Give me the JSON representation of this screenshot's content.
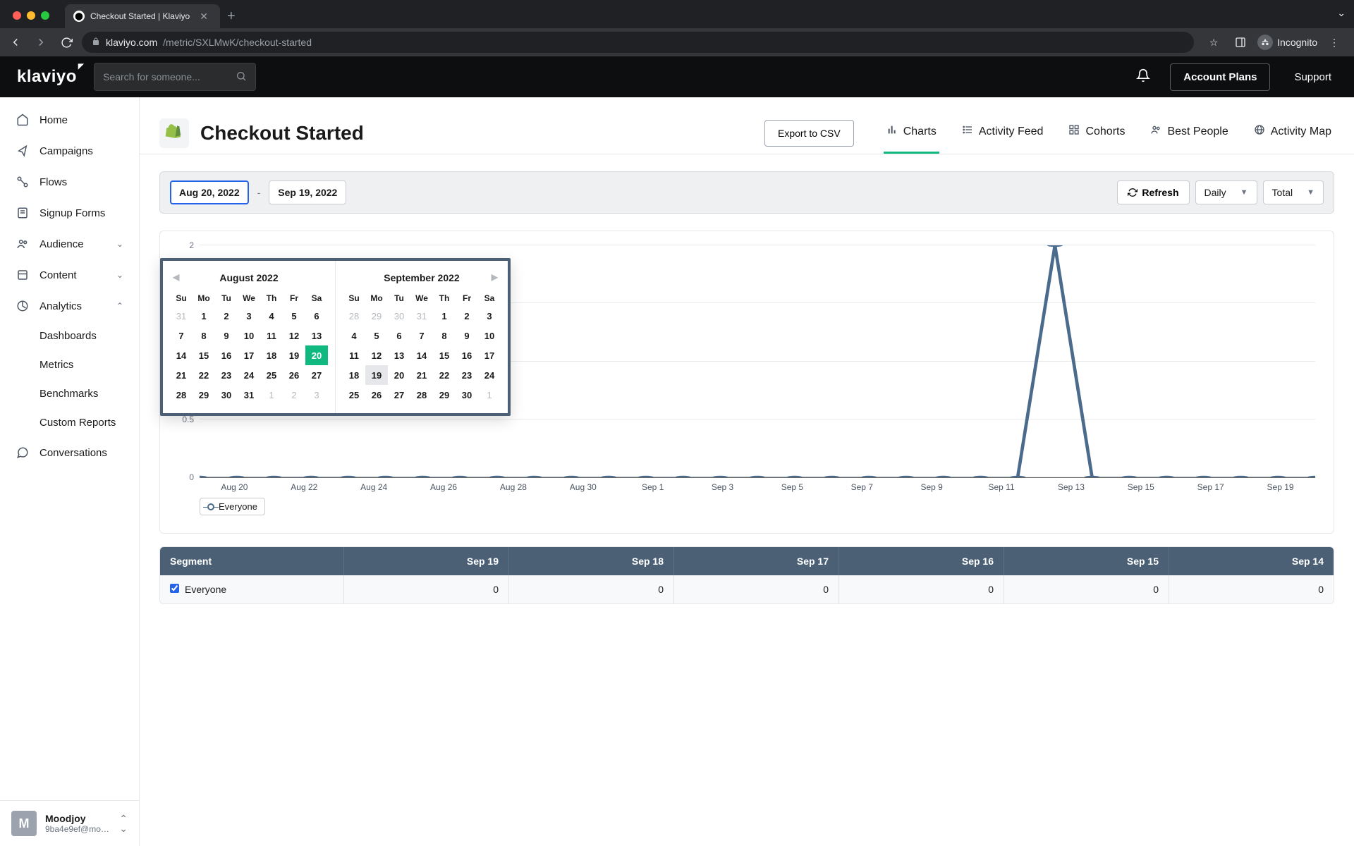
{
  "browser": {
    "tab_title": "Checkout Started | Klaviyo",
    "url_host": "klaviyo.com",
    "url_path": "/metric/SXLMwK/checkout-started",
    "incognito_label": "Incognito"
  },
  "header": {
    "logo_text": "klaviyo",
    "search_placeholder": "Search for someone...",
    "account_plans": "Account Plans",
    "support": "Support"
  },
  "sidebar": {
    "items": [
      {
        "icon": "home",
        "label": "Home"
      },
      {
        "icon": "send",
        "label": "Campaigns"
      },
      {
        "icon": "flow",
        "label": "Flows"
      },
      {
        "icon": "form",
        "label": "Signup Forms"
      },
      {
        "icon": "audience",
        "label": "Audience",
        "expandable": true
      },
      {
        "icon": "content",
        "label": "Content",
        "expandable": true
      },
      {
        "icon": "analytics",
        "label": "Analytics",
        "expandable": true,
        "expanded": true,
        "children": [
          "Dashboards",
          "Metrics",
          "Benchmarks",
          "Custom Reports"
        ]
      },
      {
        "icon": "chat",
        "label": "Conversations"
      }
    ],
    "account": {
      "avatar": "M",
      "name": "Moodjoy",
      "email": "9ba4e9ef@moo..."
    }
  },
  "page": {
    "title": "Checkout Started",
    "export_label": "Export to CSV",
    "tabs": [
      {
        "icon": "chart",
        "label": "Charts",
        "active": true
      },
      {
        "icon": "list",
        "label": "Activity Feed"
      },
      {
        "icon": "grid",
        "label": "Cohorts"
      },
      {
        "icon": "people",
        "label": "Best People"
      },
      {
        "icon": "map",
        "label": "Activity Map"
      }
    ]
  },
  "toolbar": {
    "date_from": "Aug 20, 2022",
    "date_to": "Sep 19, 2022",
    "refresh": "Refresh",
    "granularity": "Daily",
    "aggregation": "Total"
  },
  "calendar": {
    "left": {
      "title": "August 2022",
      "dow": [
        "Su",
        "Mo",
        "Tu",
        "We",
        "Th",
        "Fr",
        "Sa"
      ],
      "weeks": [
        [
          {
            "d": "31",
            "muted": true
          },
          {
            "d": "1"
          },
          {
            "d": "2"
          },
          {
            "d": "3"
          },
          {
            "d": "4"
          },
          {
            "d": "5"
          },
          {
            "d": "6"
          }
        ],
        [
          {
            "d": "7"
          },
          {
            "d": "8"
          },
          {
            "d": "9"
          },
          {
            "d": "10"
          },
          {
            "d": "11"
          },
          {
            "d": "12"
          },
          {
            "d": "13"
          }
        ],
        [
          {
            "d": "14"
          },
          {
            "d": "15"
          },
          {
            "d": "16"
          },
          {
            "d": "17"
          },
          {
            "d": "18"
          },
          {
            "d": "19"
          },
          {
            "d": "20",
            "start": true
          }
        ],
        [
          {
            "d": "21"
          },
          {
            "d": "22"
          },
          {
            "d": "23"
          },
          {
            "d": "24"
          },
          {
            "d": "25"
          },
          {
            "d": "26"
          },
          {
            "d": "27"
          }
        ],
        [
          {
            "d": "28"
          },
          {
            "d": "29"
          },
          {
            "d": "30"
          },
          {
            "d": "31"
          },
          {
            "d": "1",
            "muted": true
          },
          {
            "d": "2",
            "muted": true
          },
          {
            "d": "3",
            "muted": true
          }
        ]
      ]
    },
    "right": {
      "title": "September 2022",
      "dow": [
        "Su",
        "Mo",
        "Tu",
        "We",
        "Th",
        "Fr",
        "Sa"
      ],
      "weeks": [
        [
          {
            "d": "28",
            "muted": true
          },
          {
            "d": "29",
            "muted": true
          },
          {
            "d": "30",
            "muted": true
          },
          {
            "d": "31",
            "muted": true
          },
          {
            "d": "1"
          },
          {
            "d": "2"
          },
          {
            "d": "3"
          }
        ],
        [
          {
            "d": "4"
          },
          {
            "d": "5"
          },
          {
            "d": "6"
          },
          {
            "d": "7"
          },
          {
            "d": "8"
          },
          {
            "d": "9"
          },
          {
            "d": "10"
          }
        ],
        [
          {
            "d": "11"
          },
          {
            "d": "12"
          },
          {
            "d": "13"
          },
          {
            "d": "14"
          },
          {
            "d": "15"
          },
          {
            "d": "16"
          },
          {
            "d": "17"
          }
        ],
        [
          {
            "d": "18"
          },
          {
            "d": "19",
            "end": true
          },
          {
            "d": "20"
          },
          {
            "d": "21"
          },
          {
            "d": "22"
          },
          {
            "d": "23"
          },
          {
            "d": "24"
          }
        ],
        [
          {
            "d": "25"
          },
          {
            "d": "26"
          },
          {
            "d": "27"
          },
          {
            "d": "28"
          },
          {
            "d": "29"
          },
          {
            "d": "30"
          },
          {
            "d": "1",
            "muted": true
          }
        ]
      ]
    }
  },
  "chart_data": {
    "type": "line",
    "title": "",
    "ylabel": "",
    "ylim": [
      0,
      2
    ],
    "yticks": [
      0,
      0.5,
      1,
      1.5,
      2
    ],
    "x": [
      "Aug 20",
      "Aug 21",
      "Aug 22",
      "Aug 23",
      "Aug 24",
      "Aug 25",
      "Aug 26",
      "Aug 27",
      "Aug 28",
      "Aug 29",
      "Aug 30",
      "Aug 31",
      "Sep 1",
      "Sep 2",
      "Sep 3",
      "Sep 4",
      "Sep 5",
      "Sep 6",
      "Sep 7",
      "Sep 8",
      "Sep 9",
      "Sep 10",
      "Sep 11",
      "Sep 12",
      "Sep 13",
      "Sep 14",
      "Sep 15",
      "Sep 16",
      "Sep 17",
      "Sep 18",
      "Sep 19"
    ],
    "x_tick_labels": [
      "Aug 20",
      "Aug 22",
      "Aug 24",
      "Aug 26",
      "Aug 28",
      "Aug 30",
      "Sep 1",
      "Sep 3",
      "Sep 5",
      "Sep 7",
      "Sep 9",
      "Sep 11",
      "Sep 13",
      "Sep 15",
      "Sep 17",
      "Sep 19"
    ],
    "series": [
      {
        "name": "Everyone",
        "color": "#4b6b8c",
        "values": [
          0,
          0,
          0,
          0,
          0,
          0,
          0,
          0,
          0,
          0,
          0,
          0,
          0,
          0,
          0,
          0,
          0,
          0,
          0,
          0,
          0,
          0,
          0,
          2,
          0,
          0,
          0,
          0,
          0,
          0,
          0
        ]
      }
    ],
    "legend_label": "Everyone"
  },
  "segment_table": {
    "header_first": "Segment",
    "columns": [
      "Sep 19",
      "Sep 18",
      "Sep 17",
      "Sep 16",
      "Sep 15",
      "Sep 14"
    ],
    "rows": [
      {
        "name": "Everyone",
        "checked": true,
        "values": [
          "0",
          "0",
          "0",
          "0",
          "0",
          "0"
        ]
      }
    ]
  },
  "colors": {
    "accent": "#11b981",
    "line": "#4b6b8c",
    "header_dark": "#4b6074"
  }
}
